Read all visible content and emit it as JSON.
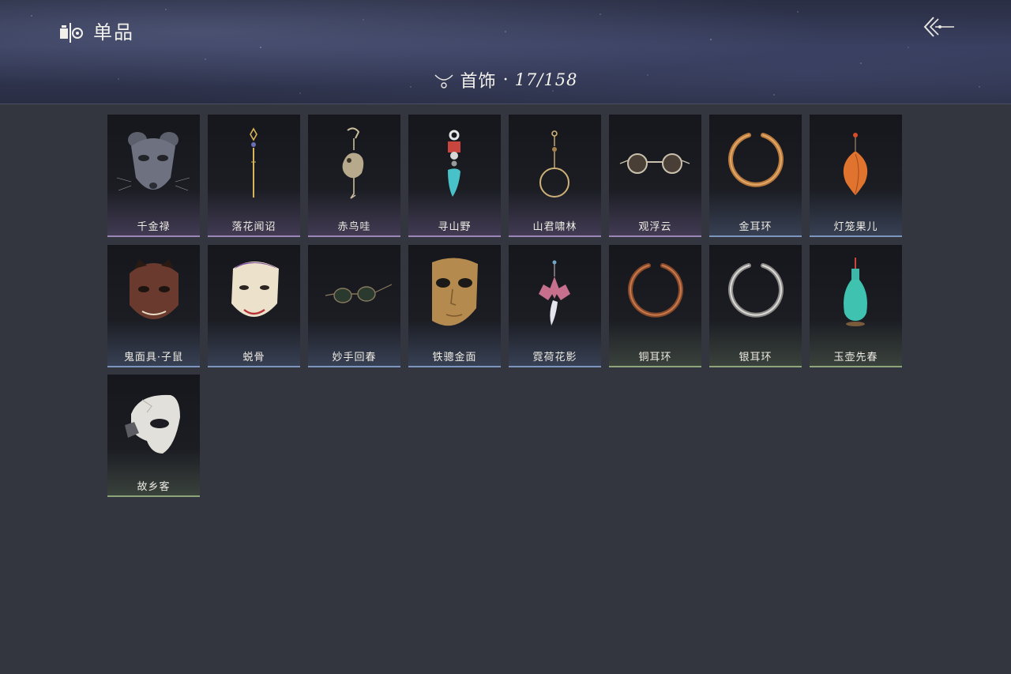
{
  "header": {
    "title": "单品",
    "app_icon": "collection-icon",
    "back_icon": "back-arrow-icon"
  },
  "category": {
    "icon": "necklace-icon",
    "name": "首饰",
    "separator": "·",
    "count": "17/158"
  },
  "items": [
    {
      "name": "千金禄",
      "icon": "rat-mask-icon",
      "tier": "purple"
    },
    {
      "name": "落花闻诏",
      "icon": "hairpin-icon",
      "tier": "purple"
    },
    {
      "name": "赤鸟哇",
      "icon": "bird-earring-icon",
      "tier": "purple"
    },
    {
      "name": "寻山野",
      "icon": "jade-pendant-icon",
      "tier": "purple"
    },
    {
      "name": "山君啸林",
      "icon": "hoop-earring-icon",
      "tier": "purple"
    },
    {
      "name": "观浮云",
      "icon": "round-glasses-icon",
      "tier": "purple"
    },
    {
      "name": "金耳环",
      "icon": "gold-earring-icon",
      "tier": "blue"
    },
    {
      "name": "灯笼果儿",
      "icon": "lantern-fruit-icon",
      "tier": "blue"
    },
    {
      "name": "鬼面具·子鼠",
      "icon": "demon-mask-icon",
      "tier": "blue"
    },
    {
      "name": "蜕骨",
      "icon": "opera-mask-icon",
      "tier": "blue"
    },
    {
      "name": "妙手回春",
      "icon": "sunglasses-icon",
      "tier": "blue"
    },
    {
      "name": "铁骢金面",
      "icon": "gold-mask-icon",
      "tier": "blue"
    },
    {
      "name": "霓荷花影",
      "icon": "flower-pendant-icon",
      "tier": "blue"
    },
    {
      "name": "铜耳环",
      "icon": "copper-earring-icon",
      "tier": "green"
    },
    {
      "name": "银耳环",
      "icon": "silver-earring-icon",
      "tier": "green"
    },
    {
      "name": "玉壶先春",
      "icon": "jade-vase-icon",
      "tier": "green"
    },
    {
      "name": "故乡客",
      "icon": "half-mask-icon",
      "tier": "green"
    }
  ],
  "colors": {
    "background": "#33363f",
    "purple_tier": "#9b86b8",
    "blue_tier": "#7c95bf",
    "green_tier": "#8ea57b"
  }
}
